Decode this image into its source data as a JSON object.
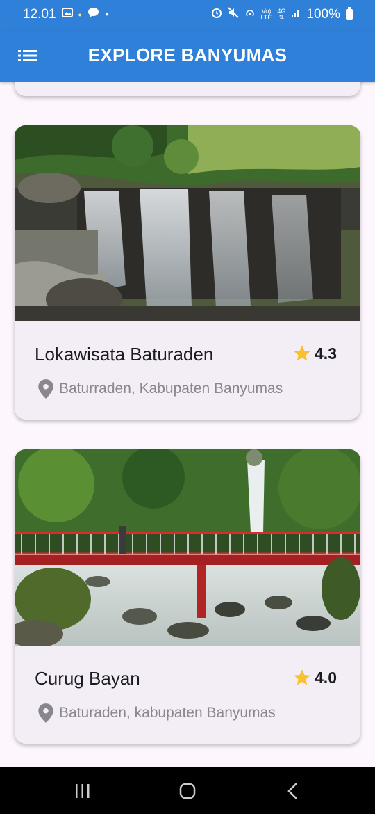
{
  "status_bar": {
    "time": "12.01",
    "notification_icons": [
      "image-icon",
      "app-icon",
      "chat-icon",
      "dot-icon"
    ],
    "system_icons": [
      "alarm-icon",
      "mute-icon",
      "hotspot-icon",
      "volte-icon",
      "4g-icon",
      "signal-icon"
    ],
    "battery": "100%"
  },
  "app_bar": {
    "title": "EXPLORE BANYUMAS",
    "menu_icon": "list-menu-icon"
  },
  "places": [
    {
      "name": "Lokawisata Baturaden",
      "rating": "4.3",
      "location": "Baturraden, Kabupaten Banyumas"
    },
    {
      "name": "Curug Bayan",
      "rating": "4.0",
      "location": "Baturaden, kabupaten Banyumas"
    }
  ],
  "colors": {
    "primary": "#2f80d8",
    "background": "#fdf7fd",
    "card": "#f3edf6",
    "star": "#fbc02d",
    "secondary_text": "#8a868d"
  },
  "nav_bar": {
    "icons": [
      "recents-icon",
      "home-icon",
      "back-icon"
    ]
  }
}
